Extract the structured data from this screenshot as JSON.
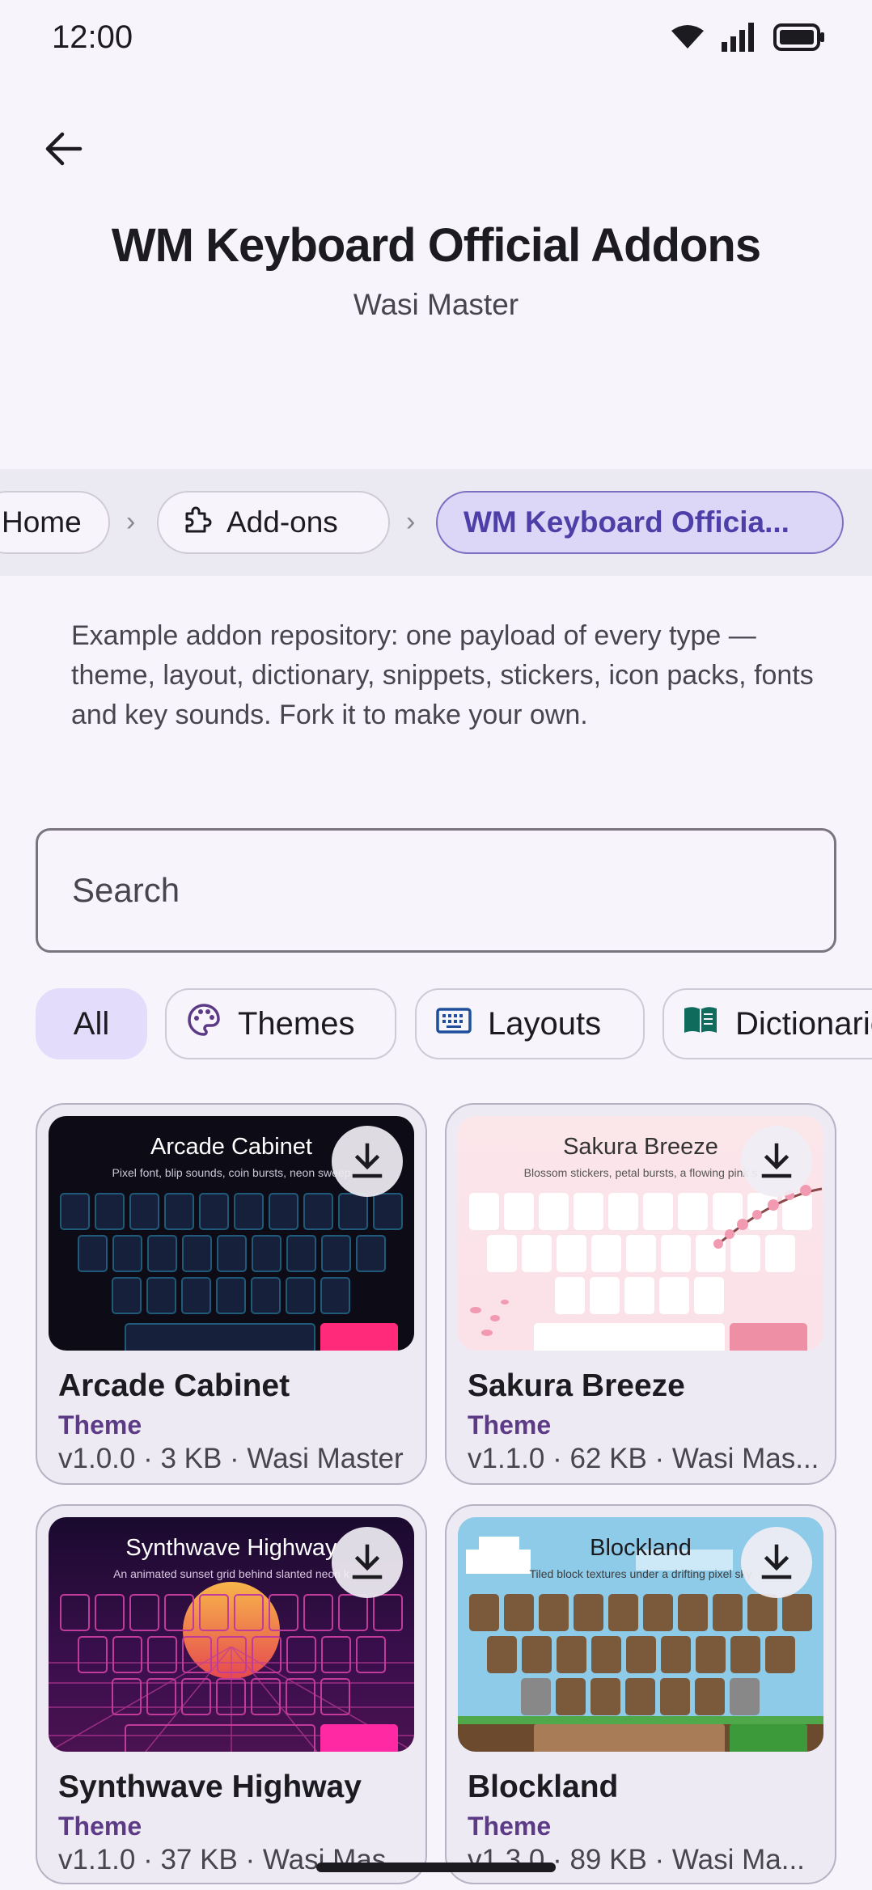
{
  "status_bar": {
    "time": "12:00"
  },
  "header": {
    "title": "WM Keyboard Official Addons",
    "subtitle": "Wasi Master"
  },
  "breadcrumb": {
    "items": [
      {
        "label": "Home"
      },
      {
        "label": "Add-ons",
        "icon": "puzzle-icon"
      },
      {
        "label": "WM Keyboard Officia...",
        "current": true
      }
    ]
  },
  "description": "Example addon repository: one payload of every type — theme, layout, dictionary, snippets, stickers, icon packs, fonts and key sounds. Fork it to make your own.",
  "search": {
    "placeholder": "Search",
    "value": ""
  },
  "filters": [
    {
      "label": "All",
      "selected": true
    },
    {
      "label": "Themes",
      "icon": "palette-icon",
      "icon_color": "#5c3a86"
    },
    {
      "label": "Layouts",
      "icon": "keyboard-icon",
      "icon_color": "#1f4e9c"
    },
    {
      "label": "Dictionaries",
      "icon": "book-icon",
      "icon_color": "#0f6b5c"
    }
  ],
  "addons": [
    {
      "name": "Arcade Cabinet",
      "type": "Theme",
      "meta": "v1.0.0 · 3 KB · Wasi Master",
      "preview_title": "Arcade Cabinet",
      "preview_sub": "Pixel font, blip sounds, coin bursts, neon sweep",
      "bg": "#0d0c16",
      "key_color": "#16203a",
      "key_border": "#1f5a78",
      "accent": "#ff2a7a",
      "text_color": "#ffffff"
    },
    {
      "name": "Sakura Breeze",
      "type": "Theme",
      "meta": "v1.1.0 · 62 KB · Wasi Mas...",
      "preview_title": "Sakura Breeze",
      "preview_sub": "Blossom stickers, petal bursts, a flowing pink s",
      "bg": "#fbe6ea",
      "key_color": "#ffffff",
      "key_border": "#fbe6ea",
      "accent": "#ee8fa6",
      "text_color": "#333333"
    },
    {
      "name": "Synthwave Highway",
      "type": "Theme",
      "meta": "v1.1.0 · 37 KB · Wasi Mas...",
      "preview_title": "Synthwave Highway",
      "preview_sub": "An animated sunset grid behind slanted neon k",
      "bg": "#2a0b3c",
      "key_color": "#2f0e45",
      "key_border": "#c13b9a",
      "accent": "#ff2aa3",
      "text_color": "#ffffff"
    },
    {
      "name": "Blockland",
      "type": "Theme",
      "meta": "v1.3.0 · 89 KB · Wasi Ma...",
      "preview_title": "Blockland",
      "preview_sub": "Tiled block textures under a drifting pixel sky",
      "bg": "#8ecbe9",
      "key_color": "#7a5a3a",
      "key_border": "#5c4028",
      "accent": "#3c9a3a",
      "text_color": "#1c1b1f"
    }
  ]
}
